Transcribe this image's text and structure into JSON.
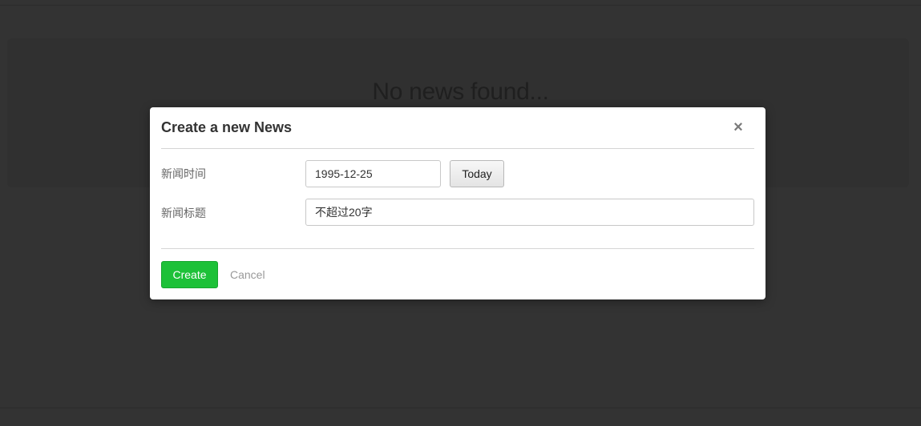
{
  "page": {
    "empty_message": "No news found..."
  },
  "modal": {
    "title": "Create a new News",
    "close_glyph": "×",
    "fields": {
      "date_label": "新闻时间",
      "date_value": "1995-12-25",
      "today_label": "Today",
      "title_label": "新闻标题",
      "title_placeholder": "不超过20字"
    },
    "footer": {
      "create_label": "Create",
      "cancel_label": "Cancel"
    }
  },
  "colors": {
    "backdrop": "#333333",
    "create_button": "#1dc138",
    "modal_background": "#ffffff"
  }
}
